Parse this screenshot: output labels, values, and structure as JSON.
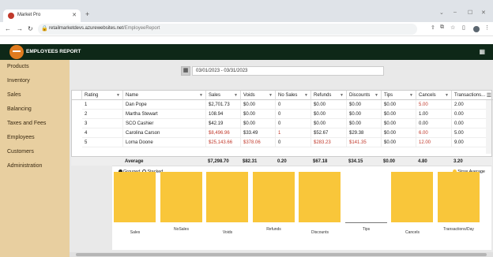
{
  "browser": {
    "tab_title": "Market Pro",
    "new_tab": "+",
    "url_host": "retailmarketdevs.azurewebsites.net",
    "url_path": "/EmployeeReport",
    "back": "←",
    "forward": "→",
    "reload": "↻",
    "minimize": "‒",
    "maximize": "☐",
    "close": "✕",
    "collapse": "⌄"
  },
  "app": {
    "title": "EMPLOYEES REPORT",
    "sidebar": [
      "Products",
      "Inventory",
      "Sales",
      "Balancing",
      "Taxes and Fees",
      "Employees",
      "Customers",
      "Administration"
    ],
    "date_range": "03/01/2023 - 03/31/2023"
  },
  "table": {
    "columns": [
      "Rating",
      "Name",
      "Sales",
      "Voids",
      "No Sales",
      "Refunds",
      "Discounts",
      "Tips",
      "Cancels",
      "Transactions..."
    ],
    "rows": [
      {
        "rating": "1",
        "name": "Dan Pope",
        "sales": "$2,701.73",
        "voids": "$0.00",
        "nosales": "0",
        "refunds": "$0.00",
        "discounts": "$0.00",
        "tips": "$0.00",
        "cancels": "5.00",
        "transactions": "2.00"
      },
      {
        "rating": "2",
        "name": "Martha Stewart",
        "sales": "108.94",
        "voids": "$0.00",
        "nosales": "0",
        "refunds": "$0.00",
        "discounts": "$0.00",
        "tips": "$0.00",
        "cancels": "1.00",
        "transactions": "0.00"
      },
      {
        "rating": "3",
        "name": "SCO Cashier",
        "sales": "$42.19",
        "voids": "$0.00",
        "nosales": "0",
        "refunds": "$0.00",
        "discounts": "$0.00",
        "tips": "$0.00",
        "cancels": "0.00",
        "transactions": "0.00"
      },
      {
        "rating": "4",
        "name": "Carolina Carson",
        "sales": "$8,496.96",
        "voids": "$33.49",
        "nosales": "1",
        "refunds": "$52.67",
        "discounts": "$29.38",
        "tips": "$0.00",
        "cancels": "6.00",
        "transactions": "5.00"
      },
      {
        "rating": "5",
        "name": "Lorna Doone",
        "sales": "$25,143.66",
        "voids": "$378.06",
        "nosales": "0",
        "refunds": "$283.23",
        "discounts": "$141.35",
        "tips": "$0.00",
        "cancels": "12.00",
        "transactions": "9.00"
      }
    ],
    "footer": {
      "label": "Average",
      "sales": "$7,298.70",
      "voids": "$82.31",
      "nosales": "0.20",
      "refunds": "$67.18",
      "discounts": "$34.15",
      "tips": "$0.00",
      "cancels": "4.80",
      "transactions": "3.20"
    }
  },
  "chart": {
    "legend_grouped": "Grouped",
    "legend_stacked": "Stacked",
    "legend_store_avg": "Store Average",
    "bar_color": "#f9c63a",
    "categories": [
      "Sales",
      "NoSales",
      "Voids",
      "Refunds",
      "Discounts",
      "Tips",
      "Cancels",
      "Transactions/Day"
    ],
    "values": [
      1,
      1,
      1,
      1,
      1,
      0,
      1,
      1
    ]
  }
}
